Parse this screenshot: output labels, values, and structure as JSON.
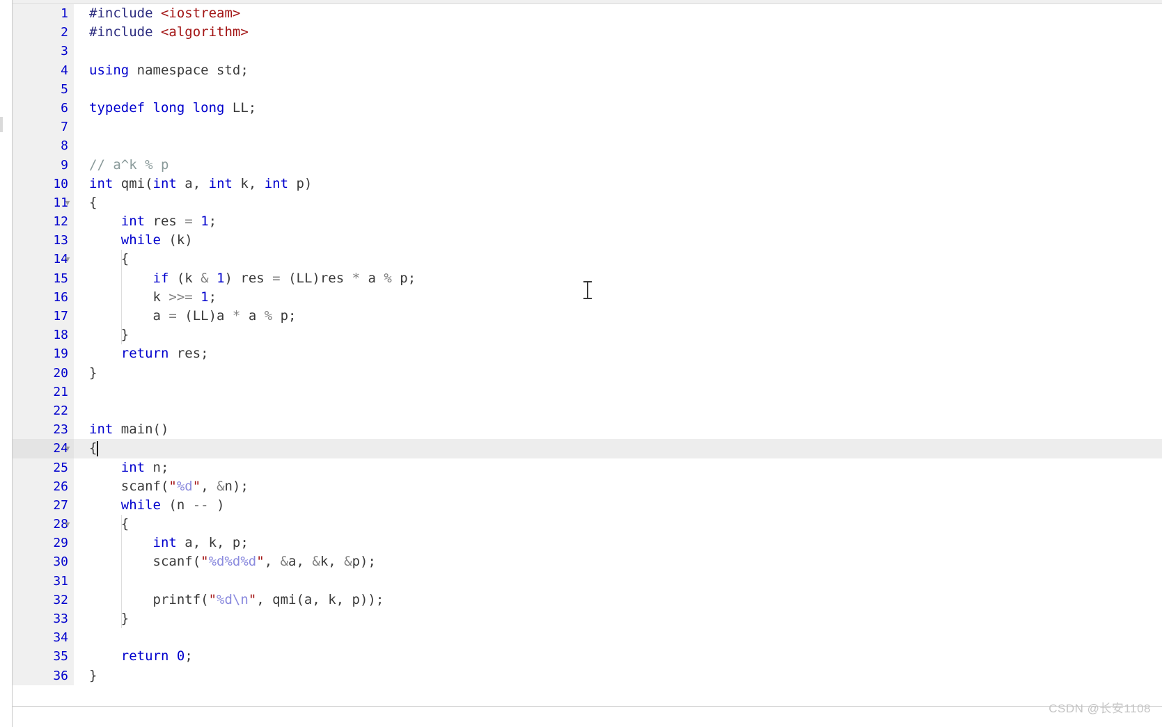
{
  "editor": {
    "language": "C++",
    "active_line": 24,
    "caret_line": 24,
    "caret_column": 2,
    "first_visible_line": 1,
    "last_visible_line": 36,
    "total_lines_visible": 36,
    "colors": {
      "background": "#ffffff",
      "gutter_background": "#f0f0f0",
      "gutter_text": "#4a4a4a",
      "active_line_background": "#ededed",
      "keyword": "#0000cd",
      "preprocessor": "#2b2b7f",
      "string": "#a31515",
      "format_specifier": "#8a8ade",
      "comment": "#8a9a9a",
      "plain_text": "#3a3a3a",
      "operator": "#808080",
      "indent_guide": "#dddddd",
      "watermark": "#c4c4c4"
    },
    "fold_markers": [
      11,
      14,
      24,
      28
    ],
    "lines": [
      {
        "n": "1",
        "tokens": [
          {
            "t": "#include ",
            "c": "pre"
          },
          {
            "t": "<iostream>",
            "c": "inc"
          }
        ]
      },
      {
        "n": "2",
        "tokens": [
          {
            "t": "#include ",
            "c": "pre"
          },
          {
            "t": "<algorithm>",
            "c": "inc"
          }
        ]
      },
      {
        "n": "3",
        "tokens": []
      },
      {
        "n": "4",
        "tokens": [
          {
            "t": "using",
            "c": "kw"
          },
          {
            "t": " namespace ",
            "c": "plain"
          },
          {
            "t": "std;",
            "c": "plain"
          }
        ]
      },
      {
        "n": "5",
        "tokens": []
      },
      {
        "n": "6",
        "tokens": [
          {
            "t": "typedef",
            "c": "kw"
          },
          {
            "t": " ",
            "c": "plain"
          },
          {
            "t": "long long",
            "c": "kw"
          },
          {
            "t": " LL;",
            "c": "plain"
          }
        ]
      },
      {
        "n": "7",
        "tokens": []
      },
      {
        "n": "8",
        "tokens": []
      },
      {
        "n": "9",
        "tokens": [
          {
            "t": "// a^k % p",
            "c": "cmt"
          }
        ]
      },
      {
        "n": "10",
        "tokens": [
          {
            "t": "int",
            "c": "kw"
          },
          {
            "t": " qmi(",
            "c": "plain"
          },
          {
            "t": "int",
            "c": "kw"
          },
          {
            "t": " a, ",
            "c": "plain"
          },
          {
            "t": "int",
            "c": "kw"
          },
          {
            "t": " k, ",
            "c": "plain"
          },
          {
            "t": "int",
            "c": "kw"
          },
          {
            "t": " p)",
            "c": "plain"
          }
        ]
      },
      {
        "n": "11",
        "fold": true,
        "tokens": [
          {
            "t": "{",
            "c": "plain"
          }
        ]
      },
      {
        "n": "12",
        "tokens": [
          {
            "t": "    ",
            "c": "plain"
          },
          {
            "t": "int",
            "c": "kw"
          },
          {
            "t": " res ",
            "c": "plain"
          },
          {
            "t": "=",
            "c": "op"
          },
          {
            "t": " ",
            "c": "plain"
          },
          {
            "t": "1",
            "c": "num"
          },
          {
            "t": ";",
            "c": "plain"
          }
        ]
      },
      {
        "n": "13",
        "tokens": [
          {
            "t": "    ",
            "c": "plain"
          },
          {
            "t": "while",
            "c": "kw"
          },
          {
            "t": " (k)",
            "c": "plain"
          }
        ]
      },
      {
        "n": "14",
        "fold": true,
        "tokens": [
          {
            "t": "    {",
            "c": "plain"
          }
        ]
      },
      {
        "n": "15",
        "tokens": [
          {
            "t": "        ",
            "c": "plain"
          },
          {
            "t": "if",
            "c": "kw"
          },
          {
            "t": " (k ",
            "c": "plain"
          },
          {
            "t": "&",
            "c": "op"
          },
          {
            "t": " ",
            "c": "plain"
          },
          {
            "t": "1",
            "c": "num"
          },
          {
            "t": ") res ",
            "c": "plain"
          },
          {
            "t": "=",
            "c": "op"
          },
          {
            "t": " (LL)res ",
            "c": "plain"
          },
          {
            "t": "*",
            "c": "op"
          },
          {
            "t": " a ",
            "c": "plain"
          },
          {
            "t": "%",
            "c": "op"
          },
          {
            "t": " p;",
            "c": "plain"
          }
        ]
      },
      {
        "n": "16",
        "tokens": [
          {
            "t": "        k ",
            "c": "plain"
          },
          {
            "t": ">>=",
            "c": "op"
          },
          {
            "t": " ",
            "c": "plain"
          },
          {
            "t": "1",
            "c": "num"
          },
          {
            "t": ";",
            "c": "plain"
          }
        ]
      },
      {
        "n": "17",
        "tokens": [
          {
            "t": "        a ",
            "c": "plain"
          },
          {
            "t": "=",
            "c": "op"
          },
          {
            "t": " (LL)a ",
            "c": "plain"
          },
          {
            "t": "*",
            "c": "op"
          },
          {
            "t": " a ",
            "c": "plain"
          },
          {
            "t": "%",
            "c": "op"
          },
          {
            "t": " p;",
            "c": "plain"
          }
        ]
      },
      {
        "n": "18",
        "tokens": [
          {
            "t": "    }",
            "c": "plain"
          }
        ]
      },
      {
        "n": "19",
        "tokens": [
          {
            "t": "    ",
            "c": "plain"
          },
          {
            "t": "return",
            "c": "kw"
          },
          {
            "t": " res;",
            "c": "plain"
          }
        ]
      },
      {
        "n": "20",
        "tokens": [
          {
            "t": "}",
            "c": "plain"
          }
        ]
      },
      {
        "n": "21",
        "tokens": []
      },
      {
        "n": "22",
        "tokens": []
      },
      {
        "n": "23",
        "tokens": [
          {
            "t": "int",
            "c": "kw"
          },
          {
            "t": " main()",
            "c": "plain"
          }
        ]
      },
      {
        "n": "24",
        "fold": true,
        "active": true,
        "caret": true,
        "tokens": [
          {
            "t": "{",
            "c": "plain"
          }
        ]
      },
      {
        "n": "25",
        "tokens": [
          {
            "t": "    ",
            "c": "plain"
          },
          {
            "t": "int",
            "c": "kw"
          },
          {
            "t": " n;",
            "c": "plain"
          }
        ]
      },
      {
        "n": "26",
        "tokens": [
          {
            "t": "    scanf(",
            "c": "plain"
          },
          {
            "t": "\"",
            "c": "str"
          },
          {
            "t": "%d",
            "c": "strb"
          },
          {
            "t": "\"",
            "c": "str"
          },
          {
            "t": ", ",
            "c": "plain"
          },
          {
            "t": "&",
            "c": "op"
          },
          {
            "t": "n);",
            "c": "plain"
          }
        ]
      },
      {
        "n": "27",
        "tokens": [
          {
            "t": "    ",
            "c": "plain"
          },
          {
            "t": "while",
            "c": "kw"
          },
          {
            "t": " (n ",
            "c": "plain"
          },
          {
            "t": "--",
            "c": "op"
          },
          {
            "t": " )",
            "c": "plain"
          }
        ]
      },
      {
        "n": "28",
        "fold": true,
        "tokens": [
          {
            "t": "    {",
            "c": "plain"
          }
        ]
      },
      {
        "n": "29",
        "tokens": [
          {
            "t": "        ",
            "c": "plain"
          },
          {
            "t": "int",
            "c": "kw"
          },
          {
            "t": " a, k, p;",
            "c": "plain"
          }
        ]
      },
      {
        "n": "30",
        "tokens": [
          {
            "t": "        scanf(",
            "c": "plain"
          },
          {
            "t": "\"",
            "c": "str"
          },
          {
            "t": "%d%d%d",
            "c": "strb"
          },
          {
            "t": "\"",
            "c": "str"
          },
          {
            "t": ", ",
            "c": "plain"
          },
          {
            "t": "&",
            "c": "op"
          },
          {
            "t": "a, ",
            "c": "plain"
          },
          {
            "t": "&",
            "c": "op"
          },
          {
            "t": "k, ",
            "c": "plain"
          },
          {
            "t": "&",
            "c": "op"
          },
          {
            "t": "p);",
            "c": "plain"
          }
        ]
      },
      {
        "n": "31",
        "tokens": []
      },
      {
        "n": "32",
        "tokens": [
          {
            "t": "        printf(",
            "c": "plain"
          },
          {
            "t": "\"",
            "c": "str"
          },
          {
            "t": "%d\\n",
            "c": "strb"
          },
          {
            "t": "\"",
            "c": "str"
          },
          {
            "t": ", qmi(a, k, p));",
            "c": "plain"
          }
        ]
      },
      {
        "n": "33",
        "tokens": [
          {
            "t": "    }",
            "c": "plain"
          }
        ]
      },
      {
        "n": "34",
        "tokens": []
      },
      {
        "n": "35",
        "tokens": [
          {
            "t": "    ",
            "c": "plain"
          },
          {
            "t": "return",
            "c": "kw"
          },
          {
            "t": " ",
            "c": "plain"
          },
          {
            "t": "0",
            "c": "num"
          },
          {
            "t": ";",
            "c": "plain"
          }
        ]
      },
      {
        "n": "36",
        "tokens": [
          {
            "t": "}",
            "c": "plain"
          }
        ]
      }
    ],
    "indent_guides": [
      {
        "from_line": 14,
        "to_line": 18,
        "indent": 1
      },
      {
        "from_line": 28,
        "to_line": 33,
        "indent": 1
      }
    ]
  },
  "watermark": {
    "text": "CSDN @长安1108"
  }
}
